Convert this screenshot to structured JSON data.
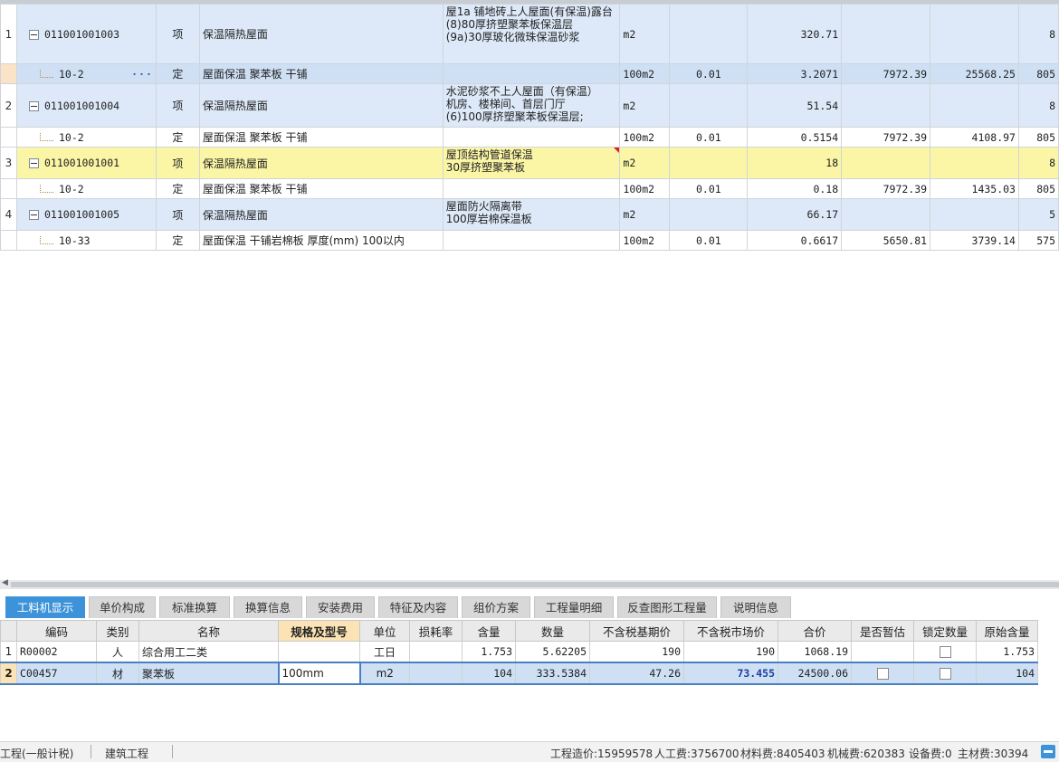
{
  "upper_rows": [
    {
      "type": "item",
      "idx": "1",
      "code": "011001001003",
      "kind": "项",
      "name": "保温隔热屋面",
      "desc": "屋1a 铺地砖上人屋面(有保温)露台\n(8)80厚挤塑聚苯板保温层\n(9a)30厚玻化微珠保温砂浆",
      "unit": "m2",
      "coef": "",
      "qty": "320.71",
      "price": "",
      "total": "",
      "extra": "8"
    },
    {
      "type": "quota",
      "idx": "",
      "code": "10-2",
      "kind": "定",
      "name": "屋面保温 聚苯板 干铺",
      "desc": "",
      "unit": "100m2",
      "coef": "0.01",
      "qty": "3.2071",
      "price": "7972.39",
      "total": "25568.25",
      "extra": "805",
      "ellipsis": "···"
    },
    {
      "type": "item",
      "idx": "2",
      "code": "011001001004",
      "kind": "项",
      "name": "保温隔热屋面",
      "desc": "水泥砂浆不上人屋面（有保温）\n机房、楼梯间、首层门厅\n(6)100厚挤塑聚苯板保温层;",
      "unit": "m2",
      "coef": "",
      "qty": "51.54",
      "price": "",
      "total": "",
      "extra": "8"
    },
    {
      "type": "quota",
      "idx": "",
      "code": "10-2",
      "kind": "定",
      "name": "屋面保温 聚苯板 干铺",
      "desc": "",
      "unit": "100m2",
      "coef": "0.01",
      "qty": "0.5154",
      "price": "7972.39",
      "total": "4108.97",
      "extra": "805"
    },
    {
      "type": "item",
      "idx": "3",
      "code": "011001001001",
      "kind": "项",
      "name": "保温隔热屋面",
      "desc": "屋顶结构管道保温\n30厚挤塑聚苯板",
      "unit": "m2",
      "coef": "",
      "qty": "18",
      "price": "",
      "total": "",
      "extra": "8"
    },
    {
      "type": "quota",
      "idx": "",
      "code": "10-2",
      "kind": "定",
      "name": "屋面保温 聚苯板 干铺",
      "desc": "",
      "unit": "100m2",
      "coef": "0.01",
      "qty": "0.18",
      "price": "7972.39",
      "total": "1435.03",
      "extra": "805"
    },
    {
      "type": "item",
      "idx": "4",
      "code": "011001001005",
      "kind": "项",
      "name": "保温隔热屋面",
      "desc": "屋面防火隔离带\n100厚岩棉保温板",
      "unit": "m2",
      "coef": "",
      "qty": "66.17",
      "price": "",
      "total": "",
      "extra": "5"
    },
    {
      "type": "quota",
      "idx": "",
      "code": "10-33",
      "kind": "定",
      "name": "屋面保温 干铺岩棉板 厚度(mm) 100以内",
      "desc": "",
      "unit": "100m2",
      "coef": "0.01",
      "qty": "0.6617",
      "price": "5650.81",
      "total": "3739.14",
      "extra": "575"
    }
  ],
  "tabs": [
    "工料机显示",
    "单价构成",
    "标准换算",
    "换算信息",
    "安装费用",
    "特征及内容",
    "组价方案",
    "工程量明细",
    "反查图形工程量",
    "说明信息"
  ],
  "lower_headers": [
    "编码",
    "类别",
    "名称",
    "规格及型号",
    "单位",
    "损耗率",
    "含量",
    "数量",
    "不含税基期价",
    "不含税市场价",
    "合价",
    "是否暂估",
    "锁定数量",
    "原始含量"
  ],
  "lower_rows": [
    {
      "idx": "1",
      "code": "R00002",
      "kind": "人",
      "name": "综合用工二类",
      "spec": "",
      "unit": "工日",
      "loss": "",
      "content": "1.753",
      "qty": "5.62205",
      "base_price": "190",
      "market_price": "190",
      "total": "1068.19",
      "provisional": false,
      "locked": false,
      "orig_content": "1.753"
    },
    {
      "idx": "2",
      "code": "C00457",
      "kind": "材",
      "name": "聚苯板",
      "spec": "100mm",
      "unit": "m2",
      "loss": "",
      "content": "104",
      "qty": "333.5384",
      "base_price": "47.26",
      "market_price": "73.455",
      "total": "24500.06",
      "provisional": false,
      "locked": false,
      "orig_content": "104"
    }
  ],
  "status": {
    "left1": "工程(一般计税)",
    "left2": "建筑工程",
    "cost": "工程造价:15959578",
    "labor": "人工费:3756700",
    "material": "材料费:8405403",
    "machine": "机械费:620383",
    "equipment": "设备费:0",
    "main_material": "主材费:30394"
  },
  "colors": {
    "accent": "#3d93d9",
    "item_row": "#dde9f8",
    "highlight_row": "#fbf6a6",
    "selection": "#cfe0f5"
  }
}
